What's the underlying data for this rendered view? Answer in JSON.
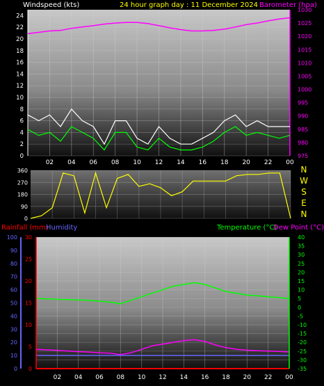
{
  "header": {
    "wind_label": "Windspeed (kts)",
    "title": "24 hour graph day : 11 December 2024",
    "baro_label": "Barometer (hpa)"
  },
  "x_ticks": [
    "02",
    "04",
    "06",
    "08",
    "10",
    "12",
    "14",
    "16",
    "18",
    "20",
    "22",
    "00"
  ],
  "wind_y_ticks": [
    "24",
    "22",
    "20",
    "18",
    "16",
    "14",
    "12",
    "10",
    "8",
    "6",
    "4",
    "2",
    "0"
  ],
  "baro_y_ticks": [
    "1030",
    "1025",
    "1020",
    "1015",
    "1010",
    "1005",
    "1000",
    "995",
    "990",
    "985",
    "980",
    "975"
  ],
  "dir_y_ticks": [
    "360",
    "270",
    "180",
    "90",
    "0"
  ],
  "compass": [
    "N",
    "W",
    "S",
    "E",
    "N"
  ],
  "lower": {
    "rain_label": "Rainfall (mm)",
    "hum_label": "Humidity",
    "temp_label": "Temperature (°C)",
    "dew_label": "Dew Point (°C)",
    "hum_ticks": [
      "100",
      "90",
      "80",
      "70",
      "60",
      "50",
      "40",
      "30",
      "20",
      "10",
      "0"
    ],
    "rain_ticks": [
      "30",
      "25",
      "20",
      "15",
      "10",
      "5",
      "0"
    ],
    "temp_ticks": [
      "40",
      "35",
      "30",
      "25",
      "20",
      "15",
      "10",
      "5",
      "0",
      "-5",
      "-10",
      "-15",
      "-20",
      "-25",
      "-30",
      "-35"
    ]
  },
  "colors": {
    "wind_label": "#ffffff",
    "title": "#ffff00",
    "baro": "#ff00ff",
    "wind_gust": "#ffffff",
    "wind_avg": "#00ff00",
    "direction": "#ffff00",
    "rain": "#ff0000",
    "humidity": "#6666ff",
    "temp": "#00ff00",
    "dew": "#ff00ff"
  },
  "chart_data": [
    {
      "type": "line",
      "title": "24 hour graph day : 11 December 2024",
      "xlabel": "",
      "ylabel": "Windspeed (kts)",
      "y2label": "Barometer (hpa)",
      "ylim": [
        0,
        25
      ],
      "y2lim": [
        975,
        1030
      ],
      "x": [
        0,
        1,
        2,
        3,
        4,
        5,
        6,
        7,
        8,
        9,
        10,
        11,
        12,
        13,
        14,
        15,
        16,
        17,
        18,
        19,
        20,
        21,
        22,
        23,
        24
      ],
      "series": [
        {
          "name": "Windspeed (kts)",
          "axis": "left",
          "values": [
            7,
            6,
            7,
            5,
            8,
            6,
            5,
            2,
            6,
            6,
            3,
            2,
            5,
            3,
            2,
            2,
            3,
            4,
            6,
            7,
            5,
            6,
            5,
            5,
            5
          ]
        },
        {
          "name": "Windspeed average",
          "axis": "left",
          "values": [
            4.5,
            3.5,
            4,
            2.5,
            5,
            4,
            3,
            1,
            4,
            4,
            1.5,
            1,
            3,
            1.5,
            1,
            1,
            1.5,
            2.5,
            4,
            5,
            3.5,
            4,
            3.5,
            3,
            3.5
          ]
        },
        {
          "name": "Barometer (hpa)",
          "axis": "right",
          "values": [
            1021,
            1021.5,
            1022,
            1022.2,
            1023,
            1023.5,
            1024,
            1024.6,
            1025,
            1025.2,
            1025.2,
            1024.8,
            1024,
            1023.2,
            1022.5,
            1022,
            1022,
            1022.2,
            1022.7,
            1023.5,
            1024.4,
            1025,
            1025.8,
            1026.5,
            1027
          ]
        }
      ]
    },
    {
      "type": "scatter",
      "title": "",
      "ylabel": "",
      "ylim": [
        0,
        360
      ],
      "x": [
        0,
        1,
        2,
        3,
        4,
        5,
        6,
        7,
        8,
        9,
        10,
        11,
        12,
        13,
        14,
        15,
        16,
        17,
        18,
        19,
        20,
        21,
        22,
        23,
        24
      ],
      "series": [
        {
          "name": "Wind direction",
          "values": [
            0,
            20,
            80,
            340,
            320,
            40,
            340,
            80,
            300,
            330,
            240,
            260,
            230,
            170,
            200,
            280,
            280,
            280,
            280,
            320,
            330,
            330,
            340,
            340,
            0
          ]
        }
      ]
    },
    {
      "type": "line",
      "title": "",
      "xlabel": "",
      "ylabel": "Rainfall (mm) / Humidity",
      "y2label": "Temperature (°C) / Dew Point (°C)",
      "ylim": [
        0,
        100
      ],
      "rainlim": [
        0,
        30
      ],
      "y2lim": [
        -35,
        40
      ],
      "x": [
        0,
        1,
        2,
        3,
        4,
        5,
        6,
        7,
        8,
        9,
        10,
        11,
        12,
        13,
        14,
        15,
        16,
        17,
        18,
        19,
        20,
        21,
        22,
        23,
        24
      ],
      "series": [
        {
          "name": "Temperature (°C)",
          "axis": "right",
          "values": [
            5,
            4.8,
            4.6,
            4.4,
            4.2,
            4,
            3.5,
            3,
            2,
            4,
            6,
            8,
            10,
            12,
            13,
            14,
            13,
            11,
            9,
            8,
            7,
            6.5,
            6,
            5.5,
            5
          ]
        },
        {
          "name": "Dew Point (°C)",
          "axis": "right",
          "values": [
            -24,
            -24.3,
            -24.6,
            -25,
            -25.3,
            -25.6,
            -26,
            -26.2,
            -27,
            -26,
            -24,
            -22,
            -21,
            -20,
            -19,
            -18.5,
            -19.5,
            -21.5,
            -23,
            -24,
            -24.5,
            -24.8,
            -25,
            -25.2,
            -25.5
          ]
        },
        {
          "name": "Humidity",
          "axis": "left",
          "values": [
            10,
            10,
            10,
            10,
            10,
            10,
            10,
            10,
            10,
            10,
            10,
            10,
            10,
            10,
            10,
            10,
            10,
            10,
            10,
            10,
            10,
            10,
            10,
            10,
            10
          ]
        },
        {
          "name": "Rainfall (mm)",
          "axis": "rain",
          "values": [
            0,
            0,
            0,
            0,
            0,
            0,
            0,
            0,
            0,
            0,
            0,
            0,
            0,
            0,
            0,
            0,
            0,
            0,
            0,
            0,
            0,
            0,
            0,
            0,
            0
          ]
        }
      ]
    }
  ]
}
